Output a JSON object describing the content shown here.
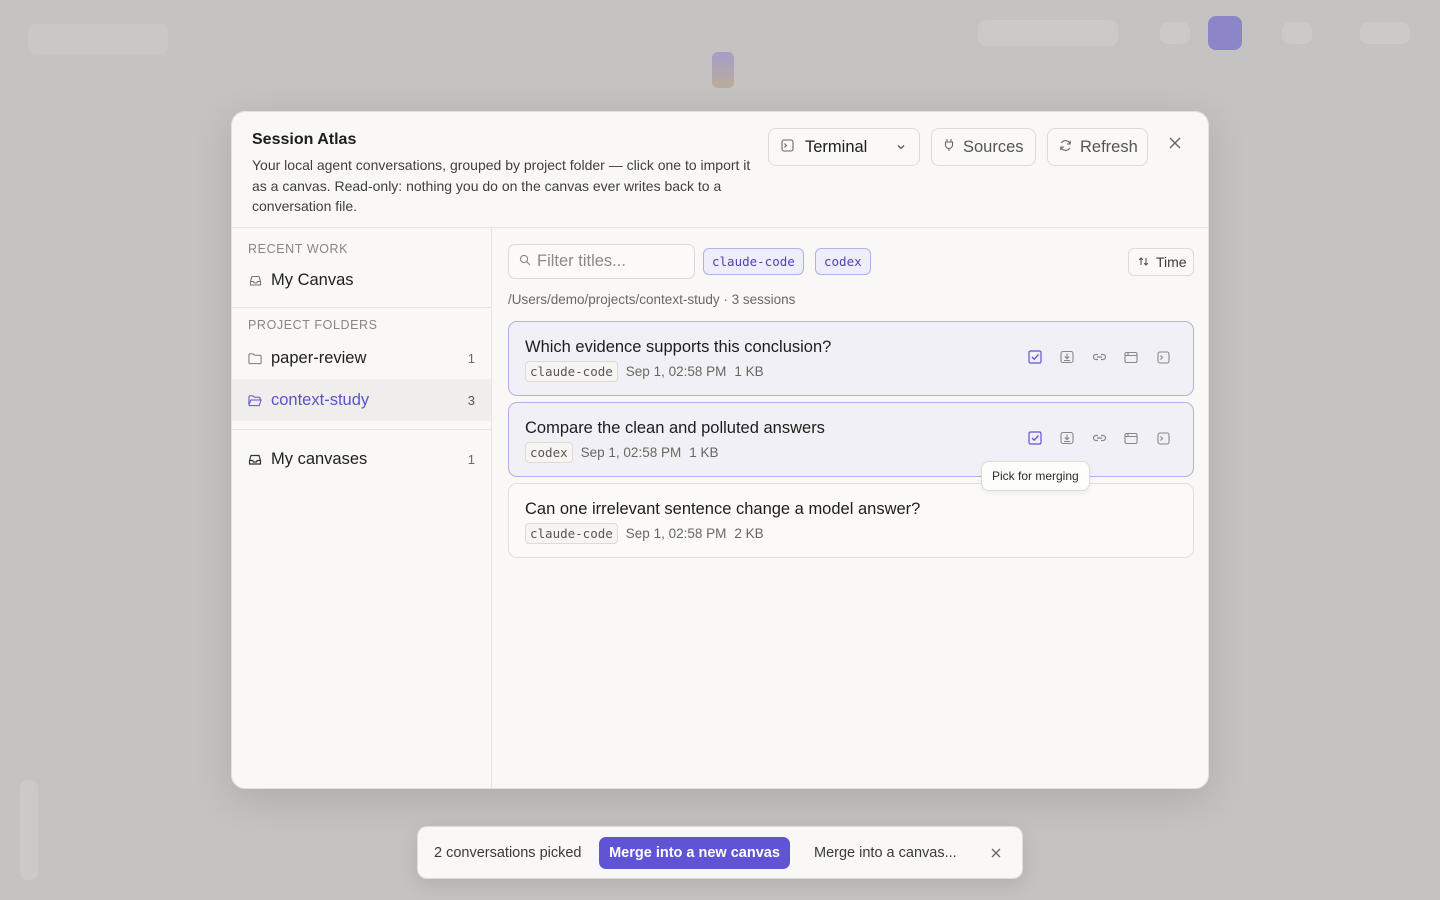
{
  "modal": {
    "title": "Session Atlas",
    "description": "Your local agent conversations, grouped by project folder — click one to import it as a canvas. Read-only: nothing you do on the canvas ever writes back to a conversation file.",
    "terminal_label": "Terminal",
    "sources_label": "Sources",
    "refresh_label": "Refresh"
  },
  "sidebar": {
    "recent_label": "RECENT WORK",
    "recent_items": [
      {
        "label": "My Canvas"
      }
    ],
    "folders_label": "PROJECT FOLDERS",
    "folders": [
      {
        "label": "paper-review",
        "count": "1"
      },
      {
        "label": "context-study",
        "count": "3",
        "active": true
      }
    ],
    "canvases": {
      "label": "My canvases",
      "count": "1"
    }
  },
  "main": {
    "filter_placeholder": "Filter titles...",
    "tags": [
      "claude-code",
      "codex"
    ],
    "sort_label": "Time",
    "path_line": "/Users/demo/projects/context-study · 3 sessions",
    "sessions": [
      {
        "title": "Which evidence supports this conclusion?",
        "source": "claude-code",
        "time": "Sep 1, 02:58 PM",
        "size": "1 KB",
        "picked": true
      },
      {
        "title": "Compare the clean and polluted answers",
        "source": "codex",
        "time": "Sep 1, 02:58 PM",
        "size": "1 KB",
        "picked": true
      },
      {
        "title": "Can one irrelevant sentence change a model answer?",
        "source": "claude-code",
        "time": "Sep 1, 02:58 PM",
        "size": "2 KB",
        "picked": false
      }
    ],
    "tooltip": "Pick for merging"
  },
  "merge_bar": {
    "count_text": "2 conversations picked",
    "primary_label": "Merge into a new canvas",
    "secondary_label": "Merge into a canvas..."
  },
  "icons": {
    "terminal": "terminal-icon",
    "sources": "plug-icon",
    "refresh": "refresh-icon",
    "close": "close-icon",
    "inbox": "inbox-icon",
    "folder": "folder-icon",
    "search": "search-icon",
    "sort": "sort-icon",
    "pick": "checkbox-icon",
    "import": "import-icon",
    "link": "link-icon",
    "window": "window-icon",
    "open_terminal": "terminal-icon"
  },
  "colors": {
    "accent": "#5e54d4",
    "accent_soft": "#eeedfa",
    "backdrop": "#bdbcba"
  }
}
